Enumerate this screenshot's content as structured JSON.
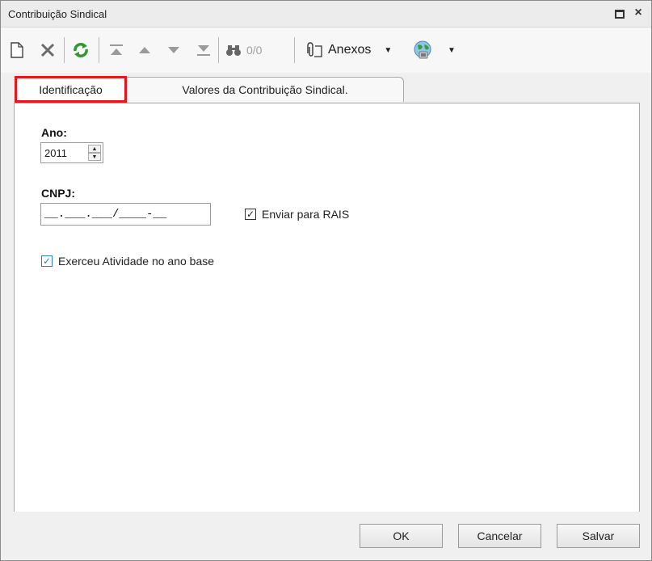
{
  "window": {
    "title": "Contribuição Sindical"
  },
  "toolbar": {
    "record_counter": "0/0",
    "attachments_label": "Anexos",
    "icons": [
      "new-document-icon",
      "delete-icon",
      "refresh-icon",
      "first-record-icon",
      "previous-record-icon",
      "next-record-icon",
      "last-record-icon",
      "binoculars-icon",
      "paperclip-icon",
      "globe-icon"
    ]
  },
  "tabs": [
    {
      "label": "Identificação",
      "active": true
    },
    {
      "label": "Valores da Contribuição Sindical.",
      "active": false
    }
  ],
  "form": {
    "ano_label": "Ano:",
    "ano_value": "2011",
    "cnpj_label": "CNPJ:",
    "cnpj_value": "__.___.___/____-__",
    "enviar_rais_label": "Enviar para RAIS",
    "enviar_rais_checked": true,
    "exerceu_label": "Exerceu Atividade no ano base",
    "exerceu_checked": true
  },
  "buttons": {
    "ok": "OK",
    "cancel": "Cancelar",
    "save": "Salvar"
  },
  "colors": {
    "highlight": "#e8151b",
    "checkbox_accent": "#2b7bd3",
    "refresh_green": "#2e9a2e"
  }
}
